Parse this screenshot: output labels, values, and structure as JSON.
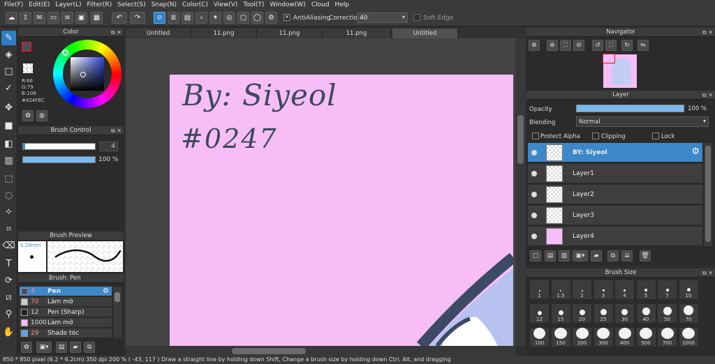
{
  "menu": [
    "File(F)",
    "Edit(E)",
    "Layer(L)",
    "Filter(R)",
    "Select(S)",
    "Snap(N)",
    "Color(C)",
    "View(V)",
    "Tool(T)",
    "Window(W)",
    "Cloud",
    "Help"
  ],
  "toolbar": {
    "antialiasing_label": "AntiAliasing",
    "correction_label": "Correction",
    "correction_value": "40",
    "soft_edge_label": "Soft Edge"
  },
  "color_panel": {
    "title": "Color",
    "r": "R:66",
    "g": "G:79",
    "b": "B:108",
    "hex": "#424F6C",
    "current_color": "#424f6c",
    "secondary_color": "#f7bdf7"
  },
  "brush_control": {
    "title": "Brush Control",
    "size_value": "4",
    "opacity_value": "100 %"
  },
  "brush_preview": {
    "title": "Brush Preview",
    "size_label": "0.29mm"
  },
  "brush_list": {
    "title": "Brush: Pen",
    "items": [
      {
        "size": "4",
        "name": "Pen",
        "color": "#424f6c"
      },
      {
        "size": "70",
        "name": "Làm mờ",
        "color": "#cccccc"
      },
      {
        "size": "12",
        "name": "Pen (Sharp)",
        "color": "#222222"
      },
      {
        "size": "1000",
        "name": "Làm mờ",
        "color": "#f7bdf7"
      },
      {
        "size": "29",
        "name": "Shade tóc",
        "color": "#5aa0e8"
      }
    ]
  },
  "tabs": [
    "Untitled",
    "11.png",
    "11.png",
    "11.png",
    "Untitled"
  ],
  "canvas": {
    "handwriting_line1": "By: Siyeol",
    "handwriting_line2": "#0247",
    "paper_color": "#f7bdf7"
  },
  "navigator": {
    "title": "Navigator"
  },
  "layers": {
    "title": "Layer",
    "opacity_label": "Opacity",
    "opacity_value": "100 %",
    "blending_label": "Blending",
    "blending_value": "Normal",
    "protect_alpha": "Protect Alpha",
    "clipping": "Clipping",
    "lock": "Lock",
    "items": [
      "BY: Siyeol",
      "Layer1",
      "Layer2",
      "Layer3",
      "Layer4"
    ]
  },
  "brush_size": {
    "title": "Brush Size",
    "sizes": [
      "1",
      "1.5",
      "2",
      "3",
      "4",
      "5",
      "7",
      "10",
      "12",
      "15",
      "20",
      "25",
      "30",
      "40",
      "50",
      "70",
      "100",
      "150",
      "200",
      "300",
      "400",
      "500",
      "700",
      "1000"
    ]
  },
  "status": "850 * 850 pixel   (6.2 * 6.2cm)   350 dpi   200 %   ( -43, 117 )   Draw a straight line by holding down Shift, Change a brush size by holding down Ctrl, Alt, and dragging"
}
